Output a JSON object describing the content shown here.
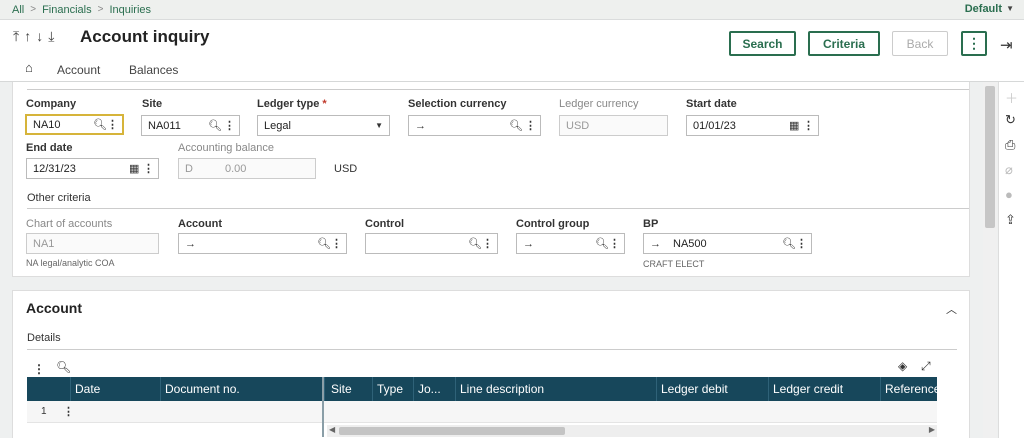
{
  "breadcrumb": [
    "All",
    "Financials",
    "Inquiries"
  ],
  "layout_selector": "Default",
  "page_title": "Account inquiry",
  "buttons": {
    "search": "Search",
    "criteria": "Criteria",
    "back": "Back"
  },
  "tabs": [
    "Account",
    "Balances"
  ],
  "selection": {
    "company": {
      "label": "Company",
      "value": "NA10"
    },
    "site": {
      "label": "Site",
      "value": "NA011"
    },
    "ledger_type": {
      "label": "Ledger type",
      "required_mark": "*",
      "value": "Legal"
    },
    "selection_currency": {
      "label": "Selection currency",
      "value": ""
    },
    "ledger_currency": {
      "label": "Ledger currency",
      "value": "USD"
    },
    "start_date": {
      "label": "Start date",
      "value": "01/01/23"
    },
    "end_date": {
      "label": "End date",
      "value": "12/31/23"
    },
    "accounting_balance": {
      "label": "Accounting balance",
      "sign": "D",
      "value": "0.00",
      "currency": "USD"
    }
  },
  "other_criteria": {
    "title": "Other criteria",
    "chart_of_accounts": {
      "label": "Chart of accounts",
      "value": "NA1",
      "description": "NA legal/analytic COA"
    },
    "account": {
      "label": "Account",
      "value": ""
    },
    "control": {
      "label": "Control",
      "value": ""
    },
    "control_group": {
      "label": "Control group",
      "value": ""
    },
    "bp": {
      "label": "BP",
      "value": "NA500",
      "description": "CRAFT ELECT"
    }
  },
  "account_section": {
    "title": "Account",
    "details_label": "Details",
    "columns": [
      "Date",
      "Document no.",
      "Site",
      "Type",
      "Jo...",
      "Line description",
      "Ledger debit",
      "Ledger credit",
      "Reference"
    ],
    "rows": [
      {
        "num": "1"
      }
    ]
  }
}
